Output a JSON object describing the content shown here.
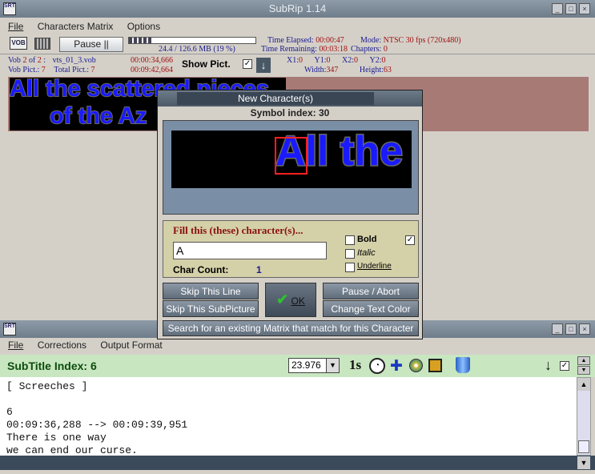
{
  "main_window": {
    "title": "SubRip 1.14",
    "icon": "srt-app-icon",
    "menu": [
      "File",
      "Characters Matrix",
      "Options"
    ],
    "pause_label": "Pause ||",
    "progress": {
      "fraction": 0.19,
      "text": "24.4 / 126.6 MB (19 %)"
    },
    "time_elapsed_label": "Time Elapsed:",
    "time_elapsed": "00:00:47",
    "time_remaining_label": "Time Remaining:",
    "time_remaining": "00:03:18",
    "mode_label": "Mode:",
    "mode": "NTSC 30 fps (720x480)",
    "chapters_label": "Chapters:",
    "chapters": "0",
    "vob_label": "Vob",
    "vob_num": "2",
    "vob_of": "of",
    "vob_total": "2",
    "vob_file": "vts_01_3.vob",
    "vob_pict_label": "Vob Pict.:",
    "vob_pict": "7",
    "total_pict_label": "Total Pict.:",
    "total_pict": "7",
    "time_a": "00:00:34,666",
    "time_b": "00:09:42,664",
    "show_pict_label": "Show Pict.",
    "coords": {
      "x1_label": "X1:",
      "x1": "0",
      "y1_label": "Y1:",
      "y1": "0",
      "x2_label": "X2:",
      "x2": "0",
      "y2_label": "Y2:",
      "y2": "0",
      "width_label": "Width:",
      "width": "347",
      "height_label": "Height:",
      "height": "63"
    },
    "sub_line1": "All the scattered pieces",
    "sub_line2": "of the Az"
  },
  "dialog": {
    "title": "New Character(s)",
    "symbol_index_label": "Symbol index:",
    "symbol_index": "30",
    "preview_text": "All the",
    "fill_label": "Fill this (these) character(s)...",
    "input_value": "A",
    "char_count_label": "Char Count:",
    "char_count": "1",
    "bold_label": "Bold",
    "italic_label": "Italic",
    "underline_label": "Underline",
    "skip_line": "Skip This Line",
    "skip_subpicture": "Skip This SubPicture",
    "ok": "OK",
    "pause_abort": "Pause / Abort",
    "change_color": "Change Text Color",
    "search_matrix": "Search for an existing Matrix that match for this Character"
  },
  "sub_window": {
    "icon": "srt-app-icon",
    "menu": [
      "File",
      "Corrections",
      "Output Format"
    ],
    "index_label": "SubTitle Index:",
    "index": "6",
    "fps": "23.976",
    "one_second_label": "1s",
    "editor_lines": [
      "[ Screeches ]",
      "",
      "6",
      "00:09:36,288 --> 00:09:39,951",
      "There is one way",
      "we can end our curse."
    ]
  },
  "colors": {
    "title_bar": "#7a8896",
    "subtitle_blue": "#1a1aff",
    "selection_red": "#ff2020",
    "green_bar": "#c8e6c0",
    "fill_panel": "#d4d0a8"
  }
}
